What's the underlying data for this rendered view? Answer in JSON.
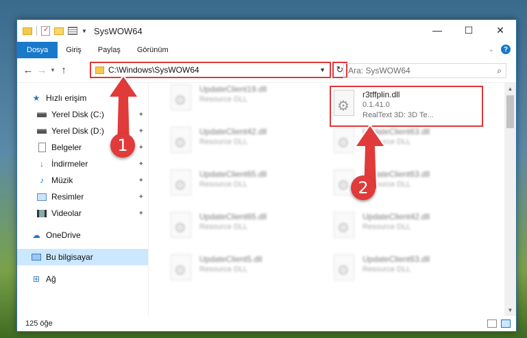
{
  "window": {
    "title": "SysWOW64"
  },
  "window_controls": {
    "minimize": "—",
    "maximize": "☐",
    "close": "✕"
  },
  "ribbon": {
    "tabs": [
      "Dosya",
      "Giriş",
      "Paylaş",
      "Görünüm"
    ],
    "help": "?"
  },
  "navbar": {
    "path": "C:\\Windows\\SysWOW64",
    "search_placeholder": "Ara: SysWOW64"
  },
  "sidebar": {
    "items": [
      {
        "label": "Hızlı erişim",
        "icon": "star-icon"
      },
      {
        "label": "Yerel Disk (C:)",
        "icon": "drive-icon"
      },
      {
        "label": "Yerel Disk (D:)",
        "icon": "drive-icon"
      },
      {
        "label": "Belgeler",
        "icon": "documents-icon"
      },
      {
        "label": "İndirmeler",
        "icon": "download-icon"
      },
      {
        "label": "Müzik",
        "icon": "music-icon"
      },
      {
        "label": "Resimler",
        "icon": "pictures-icon"
      },
      {
        "label": "Videolar",
        "icon": "video-icon"
      },
      {
        "label": "OneDrive",
        "icon": "cloud-icon"
      },
      {
        "label": "Bu bilgisayar",
        "icon": "computer-icon"
      },
      {
        "label": "Ağ",
        "icon": "network-icon"
      }
    ]
  },
  "files": {
    "highlighted": {
      "name": "r3tffplin.dll",
      "version": "0.1.41.0",
      "description": "RealText 3D:   3D Te..."
    },
    "left_column": [
      {
        "name": "UpdateClient19.dll",
        "type": "Resource DLL"
      },
      {
        "name": "UpdateClient42.dll",
        "type": "Resource DLL"
      },
      {
        "name": "UpdateClient65.dll",
        "type": "Resource DLL"
      },
      {
        "name": "UpdateClient65.dll",
        "type": "Resource DLL"
      },
      {
        "name": "UpdateClient5.dll",
        "type": "Resource DLL"
      }
    ],
    "right_column": [
      {
        "name": "UpdateClient63.dll",
        "type": "Resource DLL"
      },
      {
        "name": "UpdateClient63.dll",
        "type": "Resource DLL"
      },
      {
        "name": "UpdateClient42.dll",
        "type": "Resource DLL"
      },
      {
        "name": "UpdateClient63.dll",
        "type": "Resource DLL"
      }
    ]
  },
  "status": {
    "count": "125 öğe"
  },
  "annotations": {
    "step1": "1",
    "step2": "2"
  },
  "colors": {
    "accent": "#1979ca",
    "highlight": "#e03636",
    "selected": "#cce8ff"
  }
}
